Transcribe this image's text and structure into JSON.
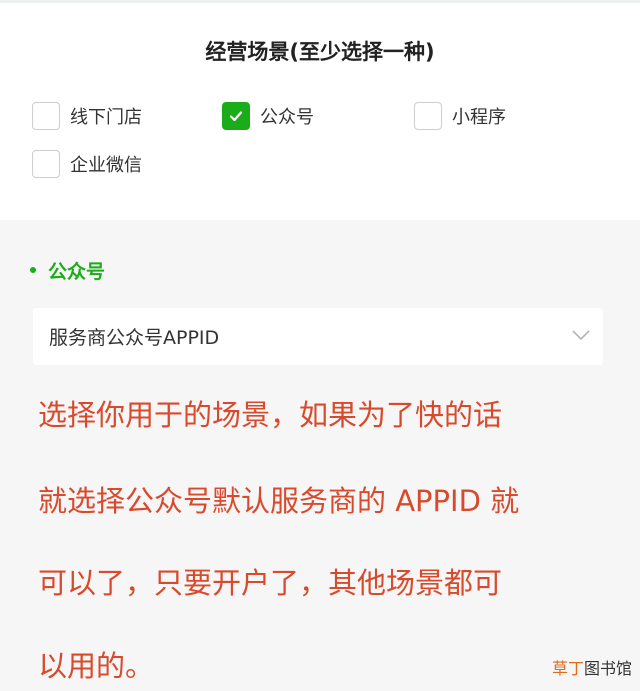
{
  "header": {
    "title": "经营场景(至少选择一种)"
  },
  "scenarios": [
    {
      "label": "线下门店",
      "checked": false
    },
    {
      "label": "公众号",
      "checked": true
    },
    {
      "label": "小程序",
      "checked": false
    },
    {
      "label": "企业微信",
      "checked": false
    }
  ],
  "section": {
    "title": "公众号",
    "select": {
      "value": "服务商公众号APPID"
    }
  },
  "annotation": {
    "lines": [
      "选择你用于的场景，如果为了快的话",
      "就选择公众号默认服务商的 APPID 就",
      "可以了，只要开户了，其他场景都可",
      "以用的。"
    ]
  },
  "watermark": {
    "part1": "草丁",
    "part2": "图书馆"
  },
  "colors": {
    "accent": "#1aad19",
    "annotation": "#d94a2c"
  }
}
